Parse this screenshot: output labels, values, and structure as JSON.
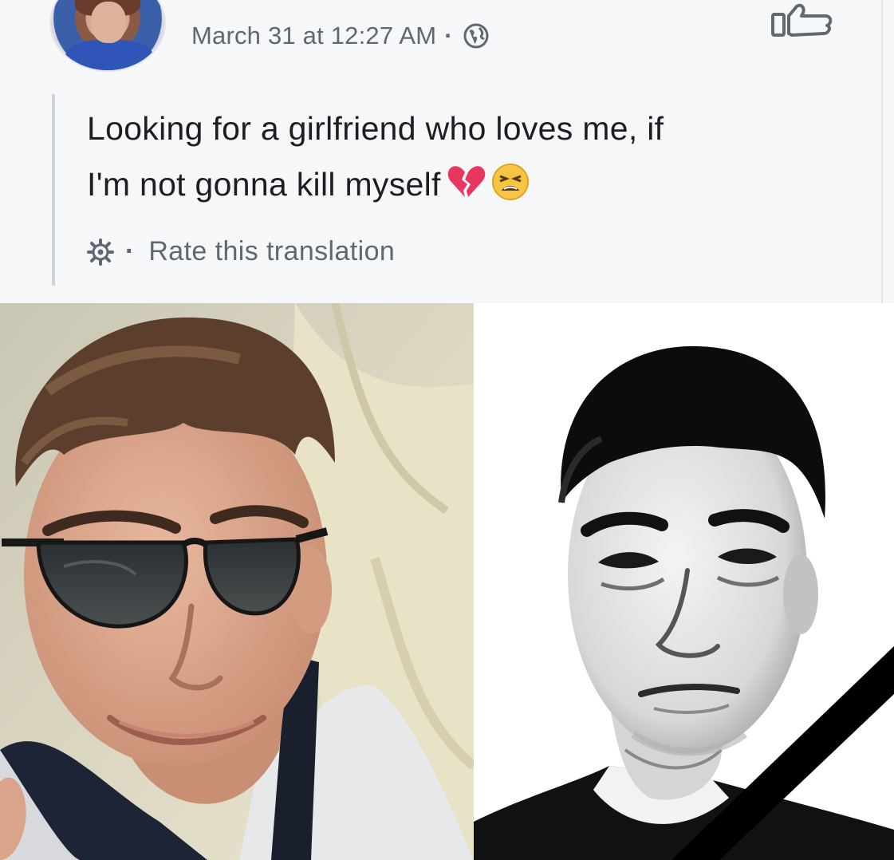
{
  "post": {
    "timestamp": "March 31 at 12:27 AM",
    "separator": "·",
    "privacy_icon": "globe-icon",
    "like_icon": "thumbs-up-icon",
    "text_line1": "Looking for a girlfriend who loves me, if",
    "text_line2": "I'm not gonna kill myself",
    "emojis": [
      "broken-heart-emoji",
      "weary-face-emoji"
    ],
    "translation": {
      "icon": "gear-icon",
      "separator": "·",
      "label": "Rate this translation"
    }
  },
  "photos": {
    "left": "photo-sunglasses",
    "right": "photo-memorial-bw"
  },
  "colors": {
    "card_bg": "#f6f7f9",
    "meta_text": "#616770",
    "body_text": "#1c1e21",
    "mourning_ribbon": "#000000"
  }
}
